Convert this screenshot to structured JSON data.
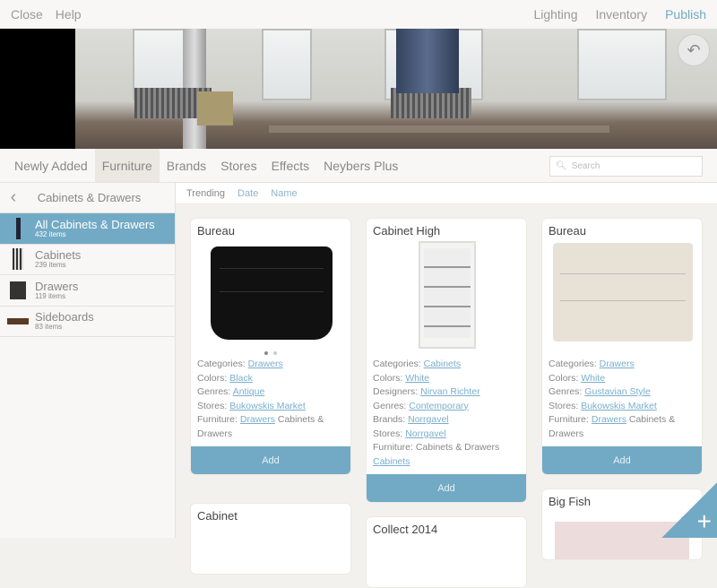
{
  "topbar": {
    "close": "Close",
    "help": "Help",
    "lighting": "Lighting",
    "inventory": "Inventory",
    "publish": "Publish"
  },
  "tabs": [
    "Newly Added",
    "Furniture",
    "Brands",
    "Stores",
    "Effects",
    "Neybers Plus"
  ],
  "active_tab": 1,
  "search": {
    "placeholder": "Search"
  },
  "sidebar": {
    "title": "Cabinets & Drawers",
    "items": [
      {
        "name": "All Cabinets & Drawers",
        "count": "432 items"
      },
      {
        "name": "Cabinets",
        "count": "239 items"
      },
      {
        "name": "Drawers",
        "count": "119 items"
      },
      {
        "name": "Sideboards",
        "count": "83 items"
      }
    ]
  },
  "sort": [
    "Trending",
    "Date",
    "Name"
  ],
  "cards": [
    {
      "title": "Bureau",
      "dots": true,
      "add": "Add",
      "props": [
        [
          {
            "t": "Categories: "
          },
          {
            "t": "Drawers",
            "l": 1
          }
        ],
        [
          {
            "t": "Colors: "
          },
          {
            "t": "Black",
            "l": 1
          }
        ],
        [
          {
            "t": "Genres: "
          },
          {
            "t": "Antique",
            "l": 1
          }
        ],
        [
          {
            "t": "Stores: "
          },
          {
            "t": "Bukowskis Market",
            "l": 1
          }
        ],
        [
          {
            "t": "Furniture: "
          },
          {
            "t": "Drawers",
            "l": 1
          },
          {
            "t": " Cabinets & Drawers"
          }
        ]
      ]
    },
    {
      "title": "Cabinet High",
      "add": "Add",
      "props": [
        [
          {
            "t": "Categories: "
          },
          {
            "t": "Cabinets",
            "l": 1
          }
        ],
        [
          {
            "t": "Colors: "
          },
          {
            "t": "White",
            "l": 1
          }
        ],
        [
          {
            "t": "Designers: "
          },
          {
            "t": "Nirvan Richter",
            "l": 1
          }
        ],
        [
          {
            "t": "Genres: "
          },
          {
            "t": "Contemporary",
            "l": 1
          }
        ],
        [
          {
            "t": "Brands: "
          },
          {
            "t": "Norrgavel",
            "l": 1
          }
        ],
        [
          {
            "t": "Stores: "
          },
          {
            "t": "Norrgavel",
            "l": 1
          }
        ],
        [
          {
            "t": "Furniture: Cabinets & Drawers "
          },
          {
            "t": "Cabinets",
            "l": 1
          }
        ]
      ]
    },
    {
      "title": "Bureau",
      "add": "Add",
      "props": [
        [
          {
            "t": "Categories: "
          },
          {
            "t": "Drawers",
            "l": 1
          }
        ],
        [
          {
            "t": "Colors: "
          },
          {
            "t": "White",
            "l": 1
          }
        ],
        [
          {
            "t": "Genres: "
          },
          {
            "t": "Gustavian Style",
            "l": 1
          }
        ],
        [
          {
            "t": "Stores: "
          },
          {
            "t": "Bukowskis Market",
            "l": 1
          }
        ],
        [
          {
            "t": "Furniture: "
          },
          {
            "t": "Drawers",
            "l": 1
          },
          {
            "t": " Cabinets & Drawers"
          }
        ]
      ]
    },
    {
      "title": "Cabinet"
    },
    {
      "title": "Collect 2014"
    },
    {
      "title": "Big Fish"
    }
  ],
  "colors": {
    "accent": "#72aac5",
    "link": "#7aaecb"
  }
}
